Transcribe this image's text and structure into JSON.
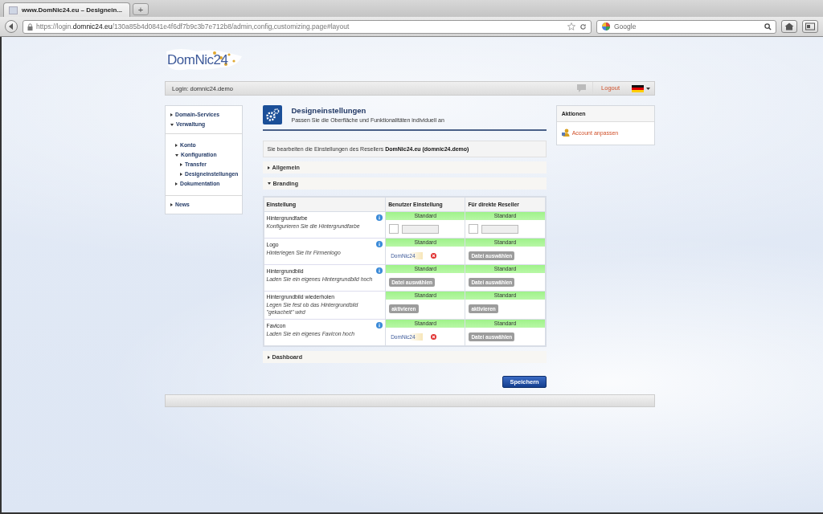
{
  "browser": {
    "tab_title": "www.DomNic24.eu – Designein...",
    "new_tab": "+",
    "url": "https://login.**domnic24.eu**/130a85b4d0841e4f6df7b9c3b7e712b8/admin,config,customizing.page#layout",
    "search_placeholder": "Google"
  },
  "site": {
    "logo": "DomNic24",
    "login": "Login: domnic24.demo",
    "logout": "Logout"
  },
  "sidebar": [
    [
      {
        "label": "Domain-Services",
        "expanded": false
      },
      {
        "label": "Verwaltung",
        "expanded": true
      }
    ],
    [
      {
        "label": "Konto",
        "expanded": false
      },
      {
        "label": "Konfiguration",
        "expanded": true,
        "children": [
          {
            "label": "Transfer",
            "expanded": false
          },
          {
            "label": "Designeinstellungen",
            "expanded": false
          }
        ]
      },
      {
        "label": "Dokumentation",
        "expanded": false
      }
    ],
    [
      {
        "label": "News",
        "expanded": false
      }
    ]
  ],
  "page": {
    "title": "Designeinstellungen",
    "subtitle": "Passen Sie die Oberfläche und Funktionalitäten individuell an"
  },
  "notice": "Sie bearbeiten die Einstellungen des Resellers **DomNic24.eu (domnic24.demo)**",
  "sections": [
    {
      "label": "Allgemein",
      "expanded": false
    },
    {
      "label": "Branding",
      "expanded": true,
      "table": {
        "columns": [
          "Einstellung",
          "Benutzer Einstellung",
          "Für direkte Reseller"
        ],
        "rows": [
          {
            "cells": [
              {
                "kind": "setting",
                "name": "Hintergrundfarbe",
                "description": "Konfigurieren Sie die Hintergrundfarbe",
                "info": true
              },
              {
                "status": "Standard",
                "kind": "color",
                "checked": false
              },
              {
                "status": "Standard",
                "kind": "color",
                "checked": false
              }
            ]
          },
          {
            "cells": [
              {
                "kind": "setting",
                "name": "Logo",
                "description": "Hinterlegen Sie Ihr Firmenlogo",
                "info": true
              },
              {
                "status": "Standard",
                "kind": "image",
                "thumbnail": "DomNic24"
              },
              {
                "status": "Standard",
                "kind": "button",
                "label": "Datei auswählen"
              }
            ]
          },
          {
            "cells": [
              {
                "kind": "setting",
                "name": "Hintergrundbild",
                "description": "Laden Sie ein eigenes Hintergrundbild hoch",
                "info": true
              },
              {
                "status": "Standard",
                "kind": "button",
                "label": "Datei auswählen"
              },
              {
                "status": "Standard",
                "kind": "button",
                "label": "Datei auswählen"
              }
            ]
          },
          {
            "cells": [
              {
                "kind": "setting",
                "name": "Hintergrundbild wiederholen",
                "description": "Legen Sie fest ob das Hintergrundbild \"gekachelt\" wird",
                "info": false
              },
              {
                "status": "Standard",
                "kind": "button",
                "label": "aktivieren"
              },
              {
                "status": "Standard",
                "kind": "button",
                "label": "aktivieren"
              }
            ]
          },
          {
            "cells": [
              {
                "kind": "setting",
                "name": "Favicon",
                "description": "Laden Sie ein eigenes Favicon hoch",
                "info": true
              },
              {
                "status": "Standard",
                "kind": "image",
                "thumbnail": "DomNic24"
              },
              {
                "status": "Standard",
                "kind": "button",
                "label": "Datei auswählen"
              }
            ]
          }
        ]
      }
    },
    {
      "label": "Dashboard",
      "expanded": false
    }
  ],
  "save": "Speichern",
  "actions": {
    "title": "Aktionen",
    "items": [
      "Account anpassen"
    ]
  }
}
